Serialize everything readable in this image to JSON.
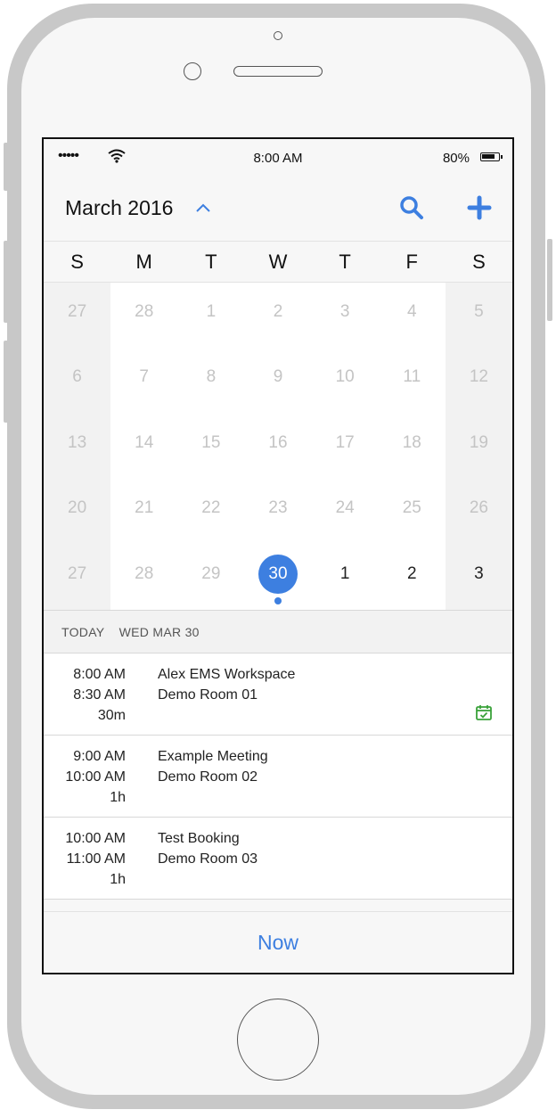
{
  "status_bar": {
    "signal": "•••••",
    "time": "8:00 AM",
    "battery": "80%"
  },
  "header": {
    "month_title": "March 2016",
    "icons": [
      "chevron-up-icon",
      "search-icon",
      "plus-icon"
    ]
  },
  "calendar": {
    "weekdays": [
      "S",
      "M",
      "T",
      "W",
      "T",
      "F",
      "S"
    ],
    "weeks": [
      [
        "27",
        "28",
        "1",
        "2",
        "3",
        "4",
        "5"
      ],
      [
        "6",
        "7",
        "8",
        "9",
        "10",
        "11",
        "12"
      ],
      [
        "13",
        "14",
        "15",
        "16",
        "17",
        "18",
        "19"
      ],
      [
        "20",
        "21",
        "22",
        "23",
        "24",
        "25",
        "26"
      ],
      [
        "27",
        "28",
        "29",
        "30",
        "1",
        "2",
        "3"
      ]
    ],
    "selected_day": "30"
  },
  "agenda": {
    "today_label": "TODAY",
    "date_label": "WED MAR 30",
    "events": [
      {
        "start": "8:00 AM",
        "end": "8:30 AM",
        "duration": "30m",
        "title": "Alex EMS Workspace",
        "room": "Demo Room 01"
      },
      {
        "start": "9:00 AM",
        "end": "10:00 AM",
        "duration": "1h",
        "title": "Example Meeting",
        "room": "Demo Room 02"
      },
      {
        "start": "10:00 AM",
        "end": "11:00 AM",
        "duration": "1h",
        "title": "Test Booking",
        "room": "Demo Room 03"
      }
    ]
  },
  "footer": {
    "now_label": "Now"
  },
  "colors": {
    "accent": "#3d7fe0",
    "check_in": "#3aa23a"
  }
}
